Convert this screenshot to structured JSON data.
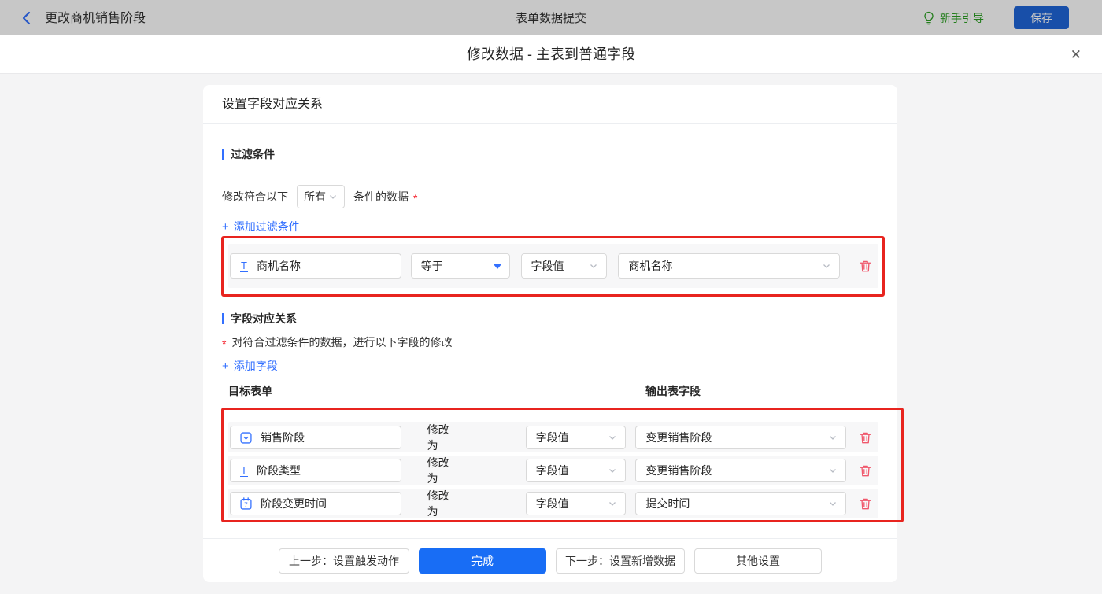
{
  "topbar": {
    "back_label": "更改商机销售阶段",
    "center_title": "表单数据提交",
    "guide_label": "新手引导",
    "save_label": "保存"
  },
  "dialog": {
    "title": "修改数据 - 主表到普通字段"
  },
  "card": {
    "header": "设置字段对应关系",
    "filter_section": {
      "title": "过滤条件",
      "match_prefix": "修改符合以下",
      "match_select_value": "所有",
      "match_suffix": "条件的数据",
      "add_link": "添加过滤条件",
      "row": {
        "field": "商机名称",
        "operator": "等于",
        "value_type": "字段值",
        "value": "商机名称"
      }
    },
    "mapping_section": {
      "title": "字段对应关系",
      "description": "对符合过滤条件的数据，进行以下字段的修改",
      "add_link": "添加字段",
      "col_left": "目标表单",
      "col_right": "输出表字段",
      "rows": [
        {
          "field": "销售阶段",
          "field_icon": "select-field-icon",
          "modify_label": "修改为",
          "value_type": "字段值",
          "value": "变更销售阶段"
        },
        {
          "field": "阶段类型",
          "field_icon": "text-field-icon",
          "modify_label": "修改为",
          "value_type": "字段值",
          "value": "变更销售阶段"
        },
        {
          "field": "阶段变更时间",
          "field_icon": "date-field-icon",
          "modify_label": "修改为",
          "value_type": "字段值",
          "value": "提交时间"
        }
      ]
    },
    "footer": {
      "prev_label": "上一步：设置触发动作",
      "done_label": "完成",
      "next_label": "下一步：设置新增数据",
      "other_label": "其他设置"
    }
  },
  "glyphs": {
    "plus": "+",
    "close": "✕",
    "text_field": "T",
    "date_digit": "7",
    "required": "*"
  },
  "colors": {
    "accent_blue": "#3370ff",
    "primary_button_blue": "#186df5",
    "save_button_blue": "#1f66d9",
    "guide_green": "#2ca023",
    "danger_red": "#f0586c",
    "annotation_red": "#e8241f",
    "required_red": "#f5222d",
    "page_bg": "#f4f4f5"
  }
}
